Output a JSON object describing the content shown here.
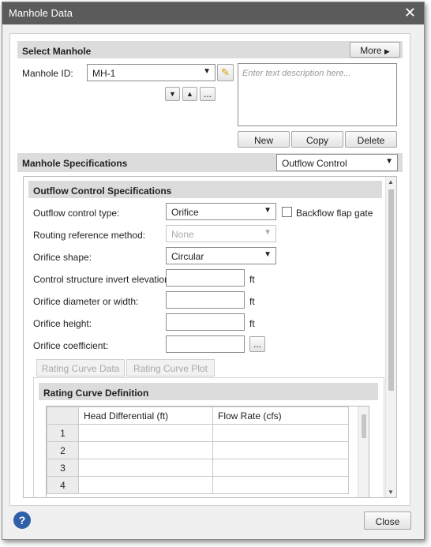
{
  "window": {
    "title": "Manhole Data"
  },
  "select_manhole": {
    "header": "Select Manhole",
    "more_label": "More",
    "manhole_id_label": "Manhole ID:",
    "manhole_id_value": "MH-1",
    "nav_more_label": "...",
    "description_placeholder": "Enter text description here...",
    "new_label": "New",
    "copy_label": "Copy",
    "delete_label": "Delete"
  },
  "specs": {
    "header": "Manhole Specifications",
    "type_value": "Outflow Control"
  },
  "outflow": {
    "header": "Outflow Control Specifications",
    "control_type_label": "Outflow control type:",
    "control_type_value": "Orifice",
    "backflow_label": "Backflow flap gate",
    "routing_label": "Routing reference method:",
    "routing_value": "None",
    "shape_label": "Orifice shape:",
    "shape_value": "Circular",
    "invert_label": "Control structure invert elevation:",
    "diameter_label": "Orifice diameter or width:",
    "height_label": "Orifice height:",
    "coefficient_label": "Orifice coefficient:",
    "unit_ft": "ft",
    "ellipsis_label": "..."
  },
  "tabs": [
    "Rating Curve Data",
    "Rating Curve Plot"
  ],
  "rating": {
    "header": "Rating Curve Definition",
    "columns": [
      "Head Differential (ft)",
      "Flow Rate (cfs)"
    ],
    "rows": [
      "1",
      "2",
      "3",
      "4"
    ]
  },
  "footer": {
    "help_glyph": "?",
    "close_label": "Close"
  }
}
